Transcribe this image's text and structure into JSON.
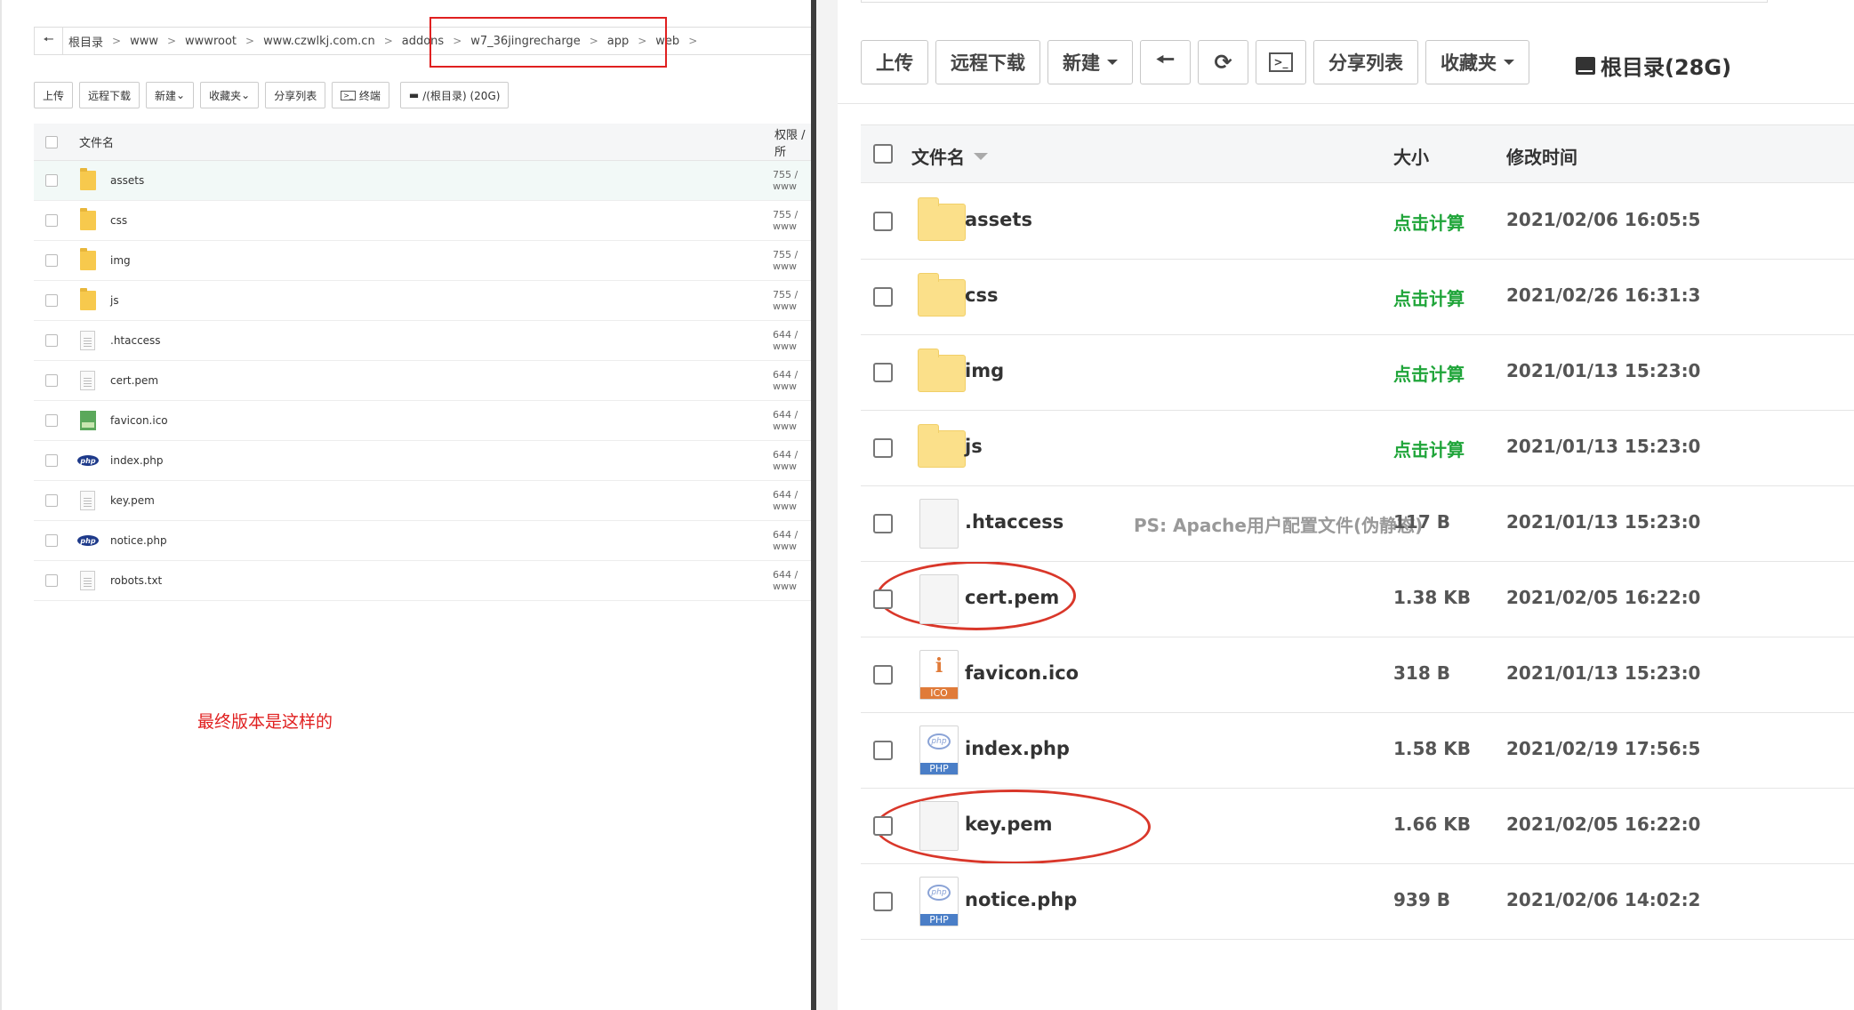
{
  "left": {
    "breadcrumb": [
      "根目录",
      "www",
      "wwwroot",
      "www.czwlkj.com.cn",
      "addons",
      "w7_36jingrecharge",
      "app",
      "web"
    ],
    "toolbar": {
      "upload": "上传",
      "remote_download": "远程下载",
      "new": "新建",
      "favorites": "收藏夹",
      "share_list": "分享列表",
      "terminal": "终端",
      "disk": "/(根目录) (20G)"
    },
    "header": {
      "name": "文件名",
      "perm": "权限 / 所"
    },
    "rows": [
      {
        "name": "assets",
        "type": "folder",
        "perm": "755 / www"
      },
      {
        "name": "css",
        "type": "folder",
        "perm": "755 / www"
      },
      {
        "name": "img",
        "type": "folder",
        "perm": "755 / www"
      },
      {
        "name": "js",
        "type": "folder",
        "perm": "755 / www"
      },
      {
        "name": ".htaccess",
        "type": "doc",
        "perm": "644 / www"
      },
      {
        "name": "cert.pem",
        "type": "doc",
        "perm": "644 / www"
      },
      {
        "name": "favicon.ico",
        "type": "image",
        "perm": "644 / www"
      },
      {
        "name": "index.php",
        "type": "php",
        "perm": "644 / www"
      },
      {
        "name": "key.pem",
        "type": "doc",
        "perm": "644 / www"
      },
      {
        "name": "notice.php",
        "type": "php",
        "perm": "644 / www"
      },
      {
        "name": "robots.txt",
        "type": "doc",
        "perm": "644 / www"
      }
    ],
    "annotation": "最终版本是这样的",
    "php_badge": "php"
  },
  "right": {
    "toolbar": {
      "upload": "上传",
      "remote_download": "远程下载",
      "new": "新建",
      "back_icon": "arrow-left-icon",
      "refresh_icon": "refresh-icon",
      "terminal_icon": "terminal-icon",
      "share_list": "分享列表",
      "favorites": "收藏夹"
    },
    "disk": "根目录(28G)",
    "header": {
      "name": "文件名",
      "size": "大小",
      "time": "修改时间"
    },
    "rows": [
      {
        "name": "assets",
        "type": "folder",
        "size": "点击计算",
        "time": "2021/02/06 16:05:5",
        "note": ""
      },
      {
        "name": "css",
        "type": "folder",
        "size": "点击计算",
        "time": "2021/02/26 16:31:3",
        "note": ""
      },
      {
        "name": "img",
        "type": "folder",
        "size": "点击计算",
        "time": "2021/01/13 15:23:0",
        "note": ""
      },
      {
        "name": "js",
        "type": "folder",
        "size": "点击计算",
        "time": "2021/01/13 15:23:0",
        "note": ""
      },
      {
        "name": ".htaccess",
        "type": "doc",
        "size": "117 B",
        "time": "2021/01/13 15:23:0",
        "note": "PS: Apache用户配置文件(伪静态)"
      },
      {
        "name": "cert.pem",
        "type": "doc",
        "size": "1.38 KB",
        "time": "2021/02/05 16:22:0",
        "note": ""
      },
      {
        "name": "favicon.ico",
        "type": "ico",
        "size": "318 B",
        "time": "2021/01/13 15:23:0",
        "note": ""
      },
      {
        "name": "index.php",
        "type": "php",
        "size": "1.58 KB",
        "time": "2021/02/19 17:56:5",
        "note": ""
      },
      {
        "name": "key.pem",
        "type": "doc",
        "size": "1.66 KB",
        "time": "2021/02/05 16:22:0",
        "note": ""
      },
      {
        "name": "notice.php",
        "type": "php",
        "size": "939 B",
        "time": "2021/02/06 14:02:2",
        "note": ""
      }
    ],
    "ico_glyph": "i",
    "ico_band": "ICO",
    "php_glyph": "php",
    "php_band": "PHP"
  },
  "colors": {
    "annotation_red": "#e02020",
    "calc_green": "#20a53a",
    "folder_yellow": "#fbe08a"
  }
}
